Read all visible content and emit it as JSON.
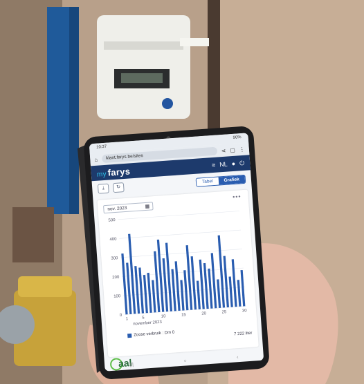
{
  "scene": {
    "colors": {
      "wall": "#b59a82",
      "pipe_blue": "#1f5a9a",
      "meter_body": "#eeeeea",
      "phone": "#1c1c1e",
      "hand": "#e3b9a6"
    }
  },
  "phone": {
    "status": {
      "time": "10:37",
      "battery": "90%"
    },
    "url": "klant.farys.be/sites",
    "app": {
      "logo_prefix": "my",
      "logo_name": "farys",
      "menu_icon": "hamburger-icon",
      "language": "NL",
      "user_icon": "user-icon",
      "power_icon": "power-icon"
    },
    "tools": {
      "download_icon": "download-icon",
      "refresh_icon": "refresh-icon"
    },
    "toggle": {
      "table_label": "Tabel",
      "chart_label": "Grafiek",
      "active": "Grafiek"
    },
    "date_picker": {
      "value": "nov. 2023",
      "icon": "calendar-icon"
    },
    "more_label": "•••",
    "legend_label": "Zoose verbruik : Dm 0",
    "total": "7 222 liter",
    "brand": "aal",
    "nav": [
      "|||",
      "○",
      "‹"
    ]
  },
  "chart_data": {
    "type": "bar",
    "xlabel": "november 2023",
    "ylim": [
      0,
      500
    ],
    "yticks": [
      0,
      100,
      200,
      300,
      400,
      500
    ],
    "xticks": [
      1,
      5,
      10,
      15,
      20,
      25,
      30
    ],
    "x": [
      1,
      2,
      3,
      4,
      5,
      6,
      7,
      8,
      9,
      10,
      11,
      12,
      13,
      14,
      15,
      16,
      17,
      18,
      19,
      20,
      21,
      22,
      23,
      24,
      25,
      26,
      27,
      28,
      29,
      30
    ],
    "values": [
      320,
      270,
      420,
      250,
      240,
      200,
      210,
      170,
      320,
      380,
      280,
      360,
      220,
      260,
      160,
      210,
      340,
      280,
      150,
      260,
      240,
      210,
      290,
      150,
      380,
      270,
      160,
      250,
      140,
      190
    ],
    "color": "#2a5db0"
  }
}
